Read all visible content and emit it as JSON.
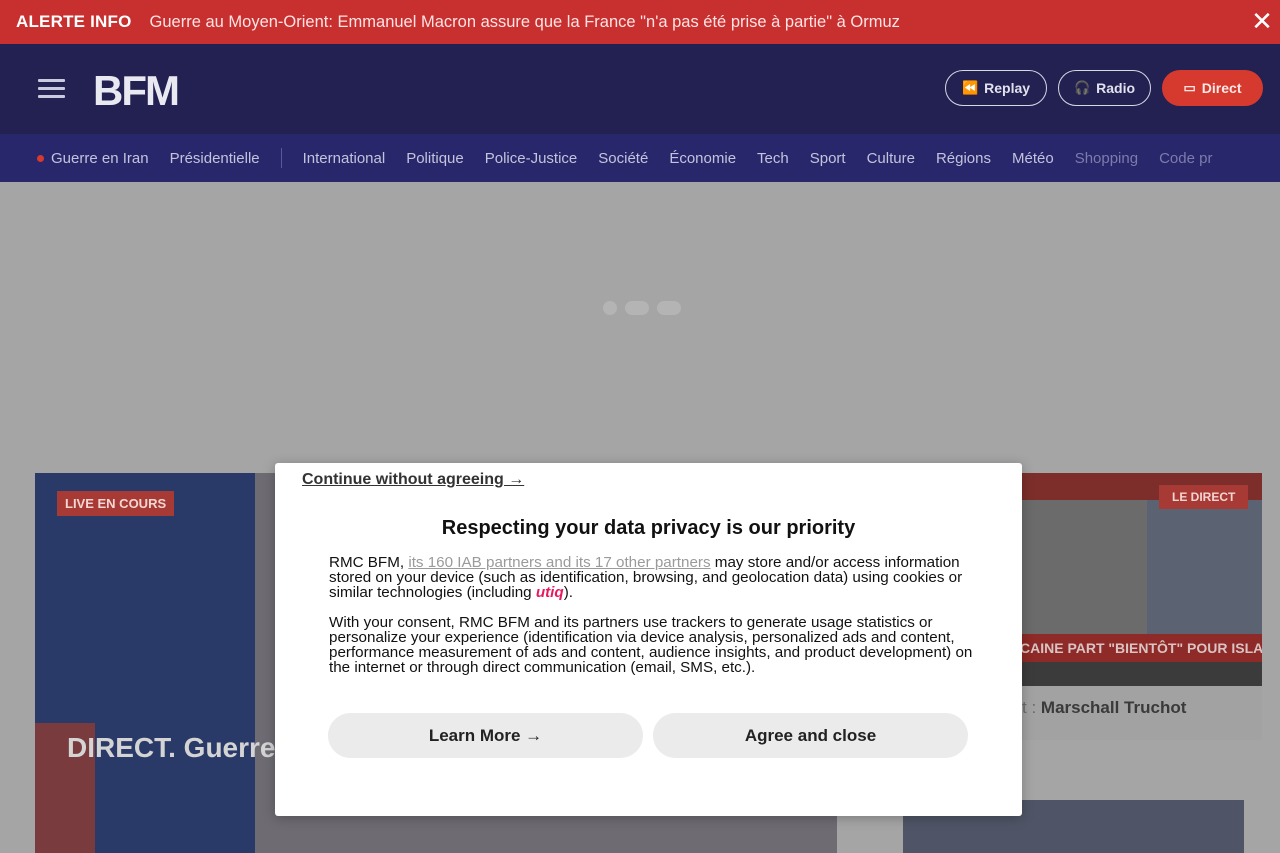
{
  "alert": {
    "tag": "ALERTE INFO",
    "text": "Guerre au Moyen-Orient: Emmanuel Macron assure que la France \"n'a pas été prise à partie\" à Ormuz",
    "close_icon": "close-icon"
  },
  "header": {
    "logo": "BFM",
    "menu_icon": "hamburger-menu-icon",
    "buttons": {
      "replay": "Replay",
      "radio": "Radio",
      "direct": "Direct"
    }
  },
  "nav": {
    "items": [
      "Guerre en Iran",
      "Présidentielle",
      "International",
      "Politique",
      "Police-Justice",
      "Société",
      "Économie",
      "Tech",
      "Sport",
      "Culture",
      "Régions",
      "Météo",
      "Shopping",
      "Code pr"
    ]
  },
  "content": {
    "hero": {
      "badge": "LIVE EN COURS",
      "headline": "DIRECT. Guerre assure que la F Ormuz"
    },
    "side": {
      "badge": "LE DIRECT",
      "banner": "CAINE PART \"BIENTÔT\" POUR ISLAMABAD",
      "title_prefix": "t :",
      "title": "Marschall Truchot"
    }
  },
  "consent": {
    "continue_link": "Continue without agreeing →",
    "title": "Respecting your data privacy is our priority",
    "p1_before": "RMC BFM,",
    "p1_link": "its 160 IAB partners and its 17 other partners",
    "p1_after": "may store and/or access information stored on your device (such as identification, browsing, and geolocation data) using cookies or similar technologies (including",
    "p1_brand": "utiq",
    "p1_end": ").",
    "p2": "With your consent, RMC BFM and its partners use trackers to generate usage statistics or personalize your experience (identification via device analysis, personalized ads and content, performance measurement of ads and content, audience insights, and product development) on the internet or through direct communication (email, SMS, etc.).",
    "learn_more": "Learn More →",
    "agree": "Agree and close"
  },
  "colors": {
    "alert_bg": "#c82f2f",
    "header_bg": "#232152",
    "nav_bg": "#29276b",
    "direct_red": "#d63a2f",
    "utiq_pink": "#e8195f"
  }
}
